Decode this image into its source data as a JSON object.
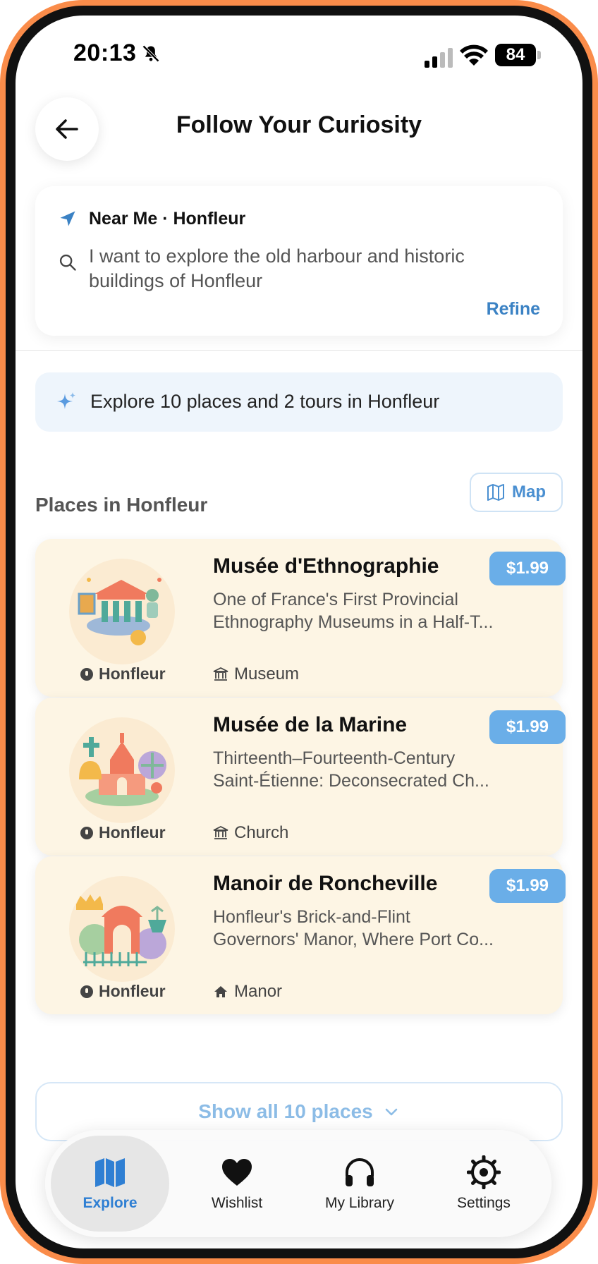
{
  "status_bar": {
    "time": "20:13",
    "battery": "84"
  },
  "header": {
    "title": "Follow Your Curiosity"
  },
  "search": {
    "location": "Near Me · Honfleur",
    "query": "I want to explore the old harbour and historic buildings of Honfleur",
    "refine_label": "Refine"
  },
  "summary": {
    "text": "Explore 10 places and 2 tours in Honfleur"
  },
  "places_section": {
    "title": "Places in Honfleur",
    "map_label": "Map"
  },
  "places": [
    {
      "title": "Musée d'Ethnographie",
      "description_line1": "One of France's First Provincial",
      "description_line2": "Ethnography Museums in a Half-T...",
      "price": "$1.99",
      "location": "Honfleur",
      "category": "Museum",
      "category_icon": "museum-icon"
    },
    {
      "title": "Musée de la Marine",
      "description_line1": "Thirteenth–Fourteenth-Century",
      "description_line2": "Saint-Étienne: Deconsecrated Ch...",
      "price": "$1.99",
      "location": "Honfleur",
      "category": "Church",
      "category_icon": "museum-icon"
    },
    {
      "title": "Manoir de Roncheville",
      "description_line1": "Honfleur's Brick-and-Flint",
      "description_line2": "Governors' Manor, Where Port Co...",
      "price": "$1.99",
      "location": "Honfleur",
      "category": "Manor",
      "category_icon": "house-icon"
    }
  ],
  "show_all": {
    "label": "Show all 10 places"
  },
  "tab_bar": {
    "tabs": [
      {
        "label": "Explore",
        "icon": "map-icon",
        "active": true
      },
      {
        "label": "Wishlist",
        "icon": "heart-icon",
        "active": false
      },
      {
        "label": "My Library",
        "icon": "headphones-icon",
        "active": false
      },
      {
        "label": "Settings",
        "icon": "gear-icon",
        "active": false
      }
    ]
  },
  "colors": {
    "accent": "#3B82C4",
    "card_bg": "#FDF5E4",
    "price_bg": "#6AAEE8",
    "frame": "#FA8C4A"
  }
}
